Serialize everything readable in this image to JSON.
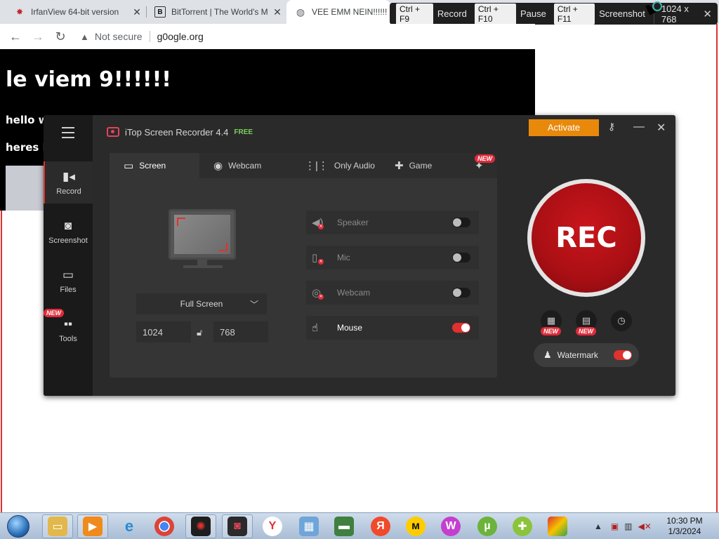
{
  "browser": {
    "tabs": [
      {
        "title": "IrfanView 64-bit version",
        "icon": "irfanview-icon"
      },
      {
        "title": "BitTorrent | The World's M",
        "icon": "bittorrent-icon"
      },
      {
        "title": "VEE EMM NEIN!!!!!!",
        "icon": "globe-icon"
      }
    ],
    "security_label": "Not secure",
    "url": "g0ogle.org"
  },
  "webpage": {
    "heading": "le viem 9!!!!!!",
    "line1": "hello wo",
    "line2": "heres k"
  },
  "hotkeys": {
    "record_key": "Ctrl + F9",
    "record_label": "Record",
    "pause_key": "Ctrl + F10",
    "pause_label": "Pause",
    "shot_key": "Ctrl + F11",
    "shot_label": "Screenshot",
    "size": "1024 x 768"
  },
  "app": {
    "title": "iTop Screen Recorder 4.4",
    "free_label": "FREE",
    "activate_label": "Activate",
    "side_nav": [
      {
        "label": "Record",
        "icon": "record-icon",
        "active": true
      },
      {
        "label": "Screenshot",
        "icon": "camera-icon",
        "active": false
      },
      {
        "label": "Files",
        "icon": "folder-icon",
        "active": false
      },
      {
        "label": "Tools",
        "icon": "tools-icon",
        "active": false,
        "badge": "NEW"
      }
    ],
    "mode_tabs": [
      {
        "label": "Screen",
        "icon": "monitor-icon",
        "active": true
      },
      {
        "label": "Webcam",
        "icon": "webcam-icon",
        "active": false
      },
      {
        "label": "Only Audio",
        "icon": "audio-wave-icon",
        "active": false
      },
      {
        "label": "Game",
        "icon": "gamepad-icon",
        "active": false
      }
    ],
    "new_badge": "NEW",
    "region": {
      "mode": "Full Screen",
      "width": "1024",
      "height": "768"
    },
    "options": [
      {
        "label": "Speaker",
        "icon": "speaker-icon",
        "enabled": false
      },
      {
        "label": "Mic",
        "icon": "mic-icon",
        "enabled": false
      },
      {
        "label": "Webcam",
        "icon": "webcam-icon",
        "enabled": false
      },
      {
        "label": "Mouse",
        "icon": "mouse-click-icon",
        "enabled": true
      }
    ],
    "rec_label": "REC",
    "watermark_label": "Watermark",
    "watermark_enabled": true
  },
  "taskbar": {
    "time": "10:30 PM",
    "date": "1/3/2024"
  },
  "colors": {
    "accent_red": "#e0312f",
    "activate_orange": "#e8890c",
    "free_green": "#7dcf5a"
  }
}
